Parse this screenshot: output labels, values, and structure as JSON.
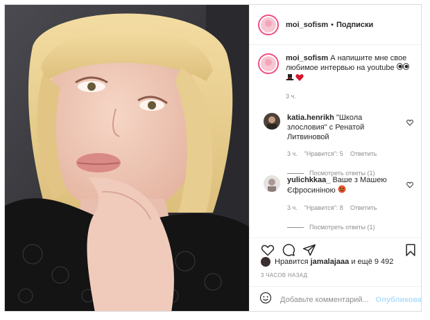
{
  "header": {
    "username": "moi_sofism",
    "separator": "•",
    "follow_label": "Подписки"
  },
  "caption": {
    "username": "moi_sofism",
    "text": "А напишите мне свое любимое интервью на youtube",
    "time": "3 ч."
  },
  "comments": [
    {
      "username": "katia.henrikh",
      "text": "\"Школа злословия\" с Ренатой Литвиновой",
      "time": "3 ч.",
      "likes": "\"Нравится\": 5",
      "reply_label": "Ответить",
      "view_replies": "Посмотреть ответы (1)"
    },
    {
      "username": "yulichkkaa_",
      "text": "Ваше з Машею Єфросиніною",
      "time": "3 ч.",
      "likes": "\"Нравится\": 8",
      "reply_label": "Ответить",
      "view_replies": "Посмотреть ответы (1)"
    }
  ],
  "likes": {
    "prefix": "Нравится",
    "user": "jamalajaaa",
    "suffix": "и ещё 9 492"
  },
  "posted_ago": "3 ЧАСОВ НАЗАД",
  "add_comment": {
    "placeholder": "Добавьте комментарий...",
    "publish_label": "Опубликовать"
  },
  "colors": {
    "border": "#dbdbdb",
    "muted_text": "#8e8e8e",
    "publish_disabled": "#b2dffc",
    "story_ring": "#f04d80"
  }
}
